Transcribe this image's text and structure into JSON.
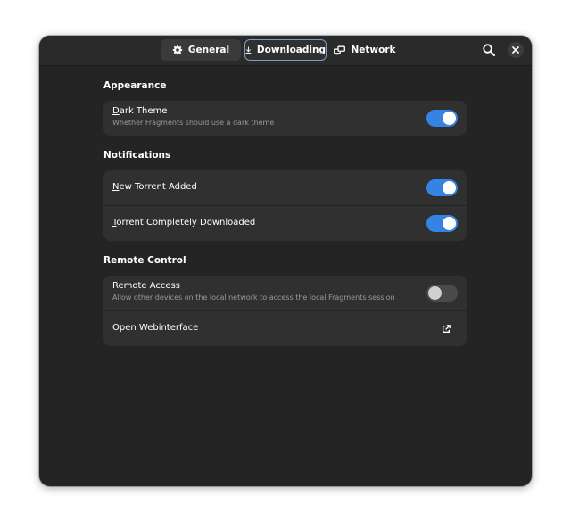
{
  "header": {
    "tabs": [
      {
        "label": "General",
        "icon": "gear-icon"
      },
      {
        "label": "Downloading",
        "icon": "download-icon",
        "selected": true
      },
      {
        "label": "Network",
        "icon": "network-icon"
      }
    ],
    "search_icon": "search-icon",
    "close_icon": "close-icon"
  },
  "appearance": {
    "title": "Appearance",
    "dark_theme": {
      "title": "Dark Theme",
      "mnemonic": "D",
      "rest": "ark Theme",
      "subtitle": "Whether Fragments should use a dark theme",
      "enabled": true
    }
  },
  "notifications": {
    "title": "Notifications",
    "new_torrent": {
      "mnemonic": "N",
      "rest": "ew Torrent Added",
      "enabled": true
    },
    "completed": {
      "mnemonic": "T",
      "rest": "orrent Completely Downloaded",
      "enabled": true
    }
  },
  "remote": {
    "title": "Remote Control",
    "access": {
      "title": "Remote Access",
      "subtitle": "Allow other devices on the local network to access the local Fragments session",
      "enabled": false
    },
    "webinterface": {
      "title": "Open Webinterface",
      "icon": "external-link-icon"
    }
  },
  "colors": {
    "accent": "#3584e4",
    "window_bg": "#242424",
    "card_bg": "#303030"
  }
}
